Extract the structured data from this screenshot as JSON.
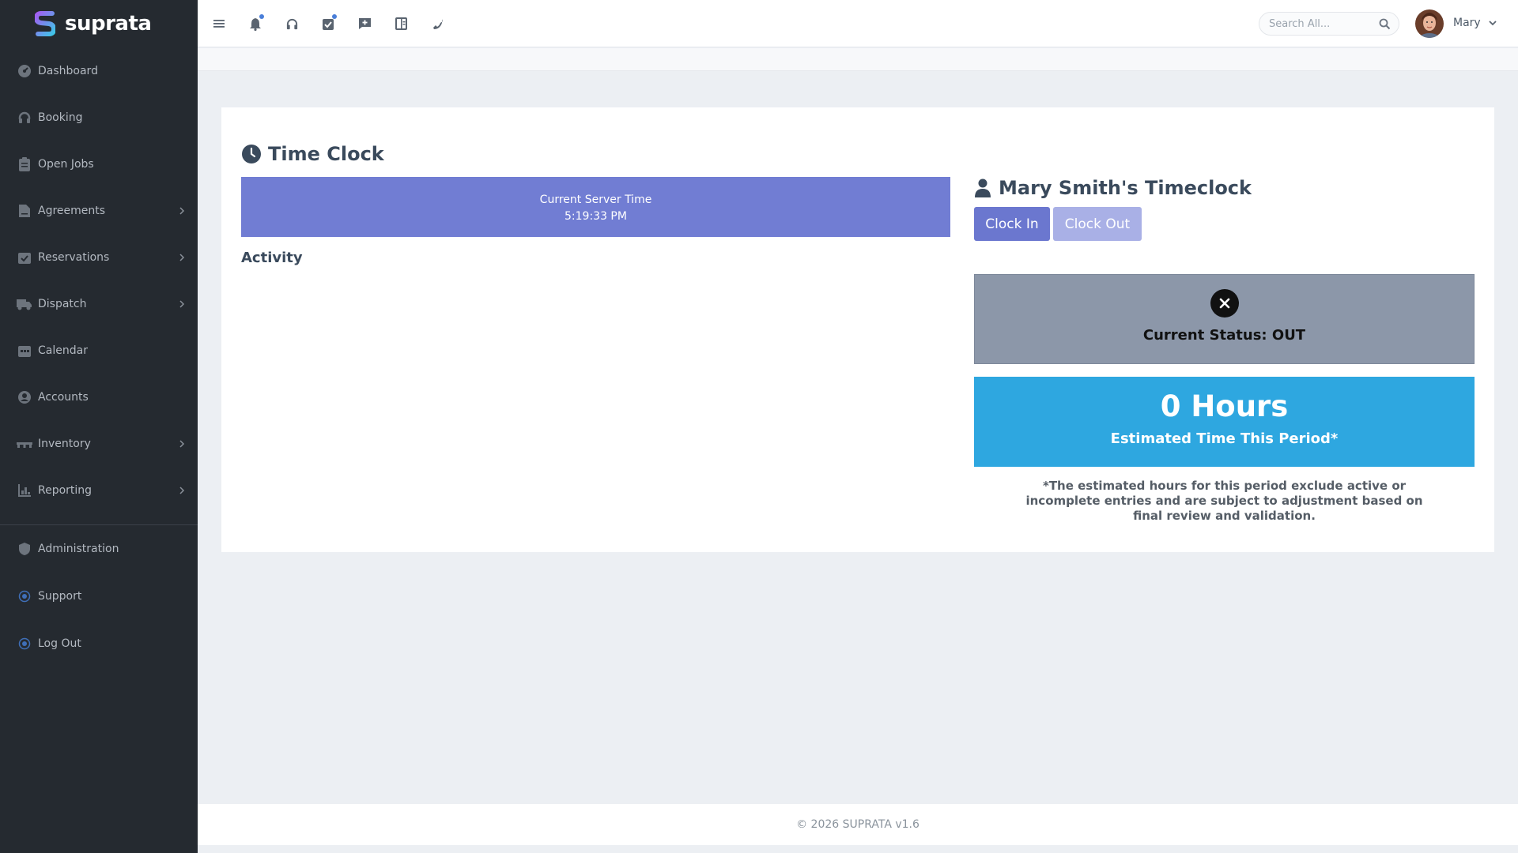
{
  "app": {
    "brand": "suprata",
    "colors": {
      "sidebar": "#252a30",
      "accent": "#717dd3",
      "info": "#2ea7e0",
      "status_out": "#8c97a9"
    }
  },
  "sidebar": {
    "items": [
      {
        "label": "Dashboard",
        "icon": "dashboard-icon",
        "has_submenu": false
      },
      {
        "label": "Booking",
        "icon": "headset-icon",
        "has_submenu": false
      },
      {
        "label": "Open Jobs",
        "icon": "clipboard-icon",
        "has_submenu": false
      },
      {
        "label": "Agreements",
        "icon": "file-contract-icon",
        "has_submenu": true
      },
      {
        "label": "Reservations",
        "icon": "calendar-check-icon",
        "has_submenu": true
      },
      {
        "label": "Dispatch",
        "icon": "truck-icon",
        "has_submenu": true
      },
      {
        "label": "Calendar",
        "icon": "calendar-icon",
        "has_submenu": false
      },
      {
        "label": "Accounts",
        "icon": "user-circle-icon",
        "has_submenu": false
      },
      {
        "label": "Inventory",
        "icon": "pallet-icon",
        "has_submenu": true
      },
      {
        "label": "Reporting",
        "icon": "chart-icon",
        "has_submenu": true
      }
    ],
    "secondary": [
      {
        "label": "Administration",
        "icon": "shield-icon"
      },
      {
        "label": "Support",
        "icon": "radio-dot-icon"
      },
      {
        "label": "Log Out",
        "icon": "radio-dot-icon"
      }
    ]
  },
  "topbar": {
    "icons": [
      "menu-icon",
      "bell-icon",
      "headset-icon",
      "task-icon",
      "message-plus-icon",
      "ledger-icon",
      "phone-icon"
    ],
    "search_placeholder": "Search All...",
    "user_name": "Mary"
  },
  "page": {
    "title": "Time Clock",
    "server_time_label": "Current Server Time",
    "server_time_value": "5:19:33 PM",
    "activity_label": "Activity",
    "timeclock_title": "Mary Smith's Timeclock",
    "clock_in_label": "Clock In",
    "clock_out_label": "Clock Out",
    "status_text": "Current Status: OUT",
    "hours_value": "0 Hours",
    "hours_label": "Estimated Time This Period*",
    "note": "*The estimated hours for this period exclude active or incomplete entries and are subject to adjustment based on final review and validation."
  },
  "footer": {
    "text": "© 2026 SUPRATA v1.6"
  }
}
